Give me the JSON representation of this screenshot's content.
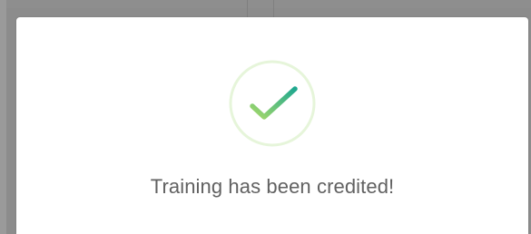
{
  "dialog": {
    "icon": "success-check-icon",
    "message": "Training has been credited!"
  },
  "colors": {
    "check_start": "#a6d96a",
    "check_end": "#1fa88f",
    "ring": "#e6f5da",
    "text": "#616161",
    "overlay": "#8c8c8c"
  }
}
